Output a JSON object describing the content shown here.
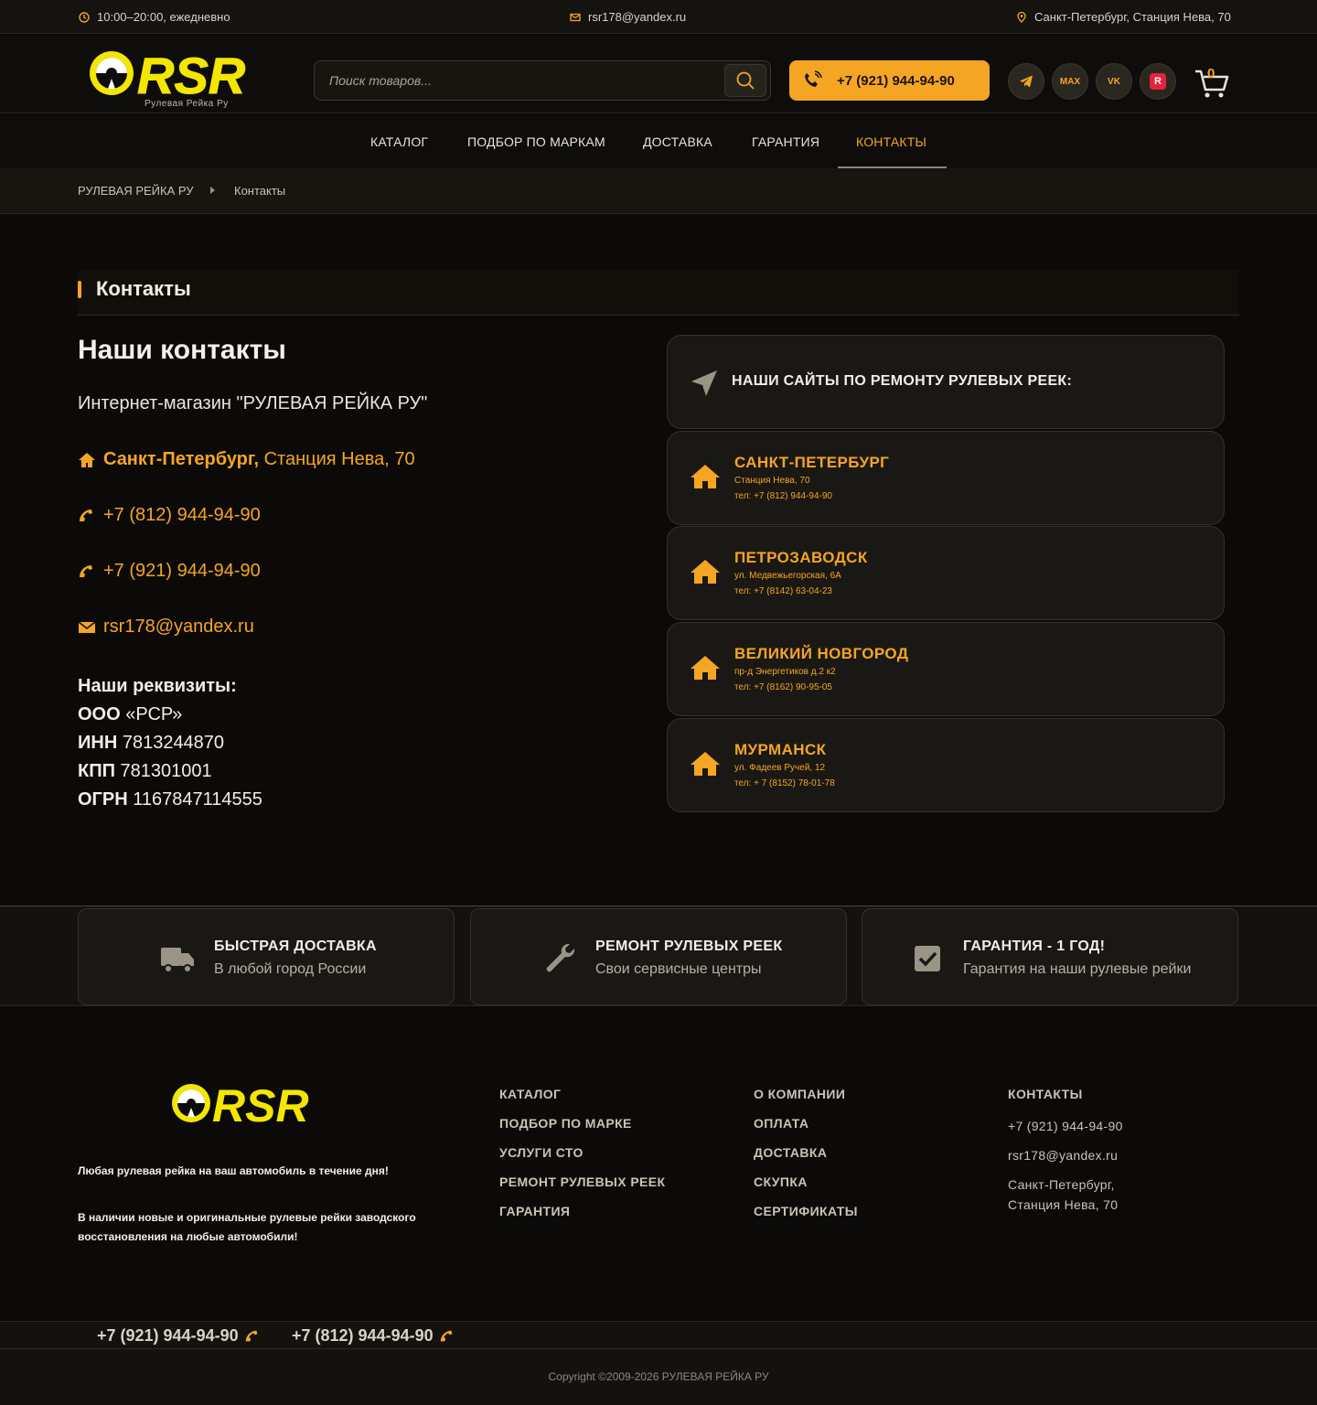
{
  "topbar": {
    "hours": "10:00–20:00, ежедневно",
    "email": "rsr178@yandex.ru",
    "address": "Санкт-Петербург, Станция Нева, 70"
  },
  "header": {
    "logo_text": "RSR",
    "logo_subtitle": "Рулевая Рейка Ру",
    "search_placeholder": "Поиск товаров...",
    "phone": "+7 (921) 944-94-90",
    "social": {
      "max": "MAX",
      "vk": "VK",
      "r": "R"
    },
    "cart_count": "0"
  },
  "nav": {
    "items": [
      {
        "label": "КАТАЛОГ"
      },
      {
        "label": "ПОДБОР ПО МАРКАМ"
      },
      {
        "label": "ДОСТАВКА"
      },
      {
        "label": "ГАРАНТИЯ"
      },
      {
        "label": "КОНТАКТЫ"
      }
    ],
    "active": "КОНТАКТЫ"
  },
  "breadcrumb": {
    "home": "РУЛЕВАЯ РЕЙКА РУ",
    "current": "Контакты"
  },
  "page": {
    "title": "Контакты",
    "heading": "Наши контакты",
    "shop_name": "Интернет-магазин \"РУЛЕВАЯ РЕЙКА РУ\"",
    "city": "Санкт-Петербург,",
    "street": " Станция Нева, 70",
    "phone1": "+7 (812) 944-94-90",
    "phone2": "+7 (921) 944-94-90",
    "email": "rsr178@yandex.ru",
    "requisites": {
      "title": "Наши реквизиты:",
      "org_label": "ООО",
      "org_value": " «РСР»",
      "inn_label": "ИНН",
      "inn_value": " 7813244870",
      "kpp_label": "КПП",
      "kpp_value": " 781301001",
      "ogrn_label": "ОГРН",
      "ogrn_value": " 1167847114555"
    }
  },
  "sites": {
    "heading": "НАШИ САЙТЫ ПО РЕМОНТУ РУЛЕВЫХ РЕЕК:",
    "cities": [
      {
        "name": "САНКТ-ПЕТЕРБУРГ",
        "address": "Станция Нева, 70",
        "tel": "тел: +7 (812) 944-94-90"
      },
      {
        "name": "ПЕТРОЗАВОДСК",
        "address": "ул. Медвежьегорская, 6А",
        "tel": "тел: +7 (8142) 63-04-23"
      },
      {
        "name": "ВЕЛИКИЙ НОВГОРОД",
        "address": "пр-д Энергетиков д.2 к2",
        "tel": "тел: +7 (8162) 90-95-05"
      },
      {
        "name": "МУРМАНСК",
        "address": "ул. Фадеев Ручей, 12",
        "tel": "тел: + 7 (8152) 78-01-78"
      }
    ]
  },
  "features": [
    {
      "title": "БЫСТРАЯ ДОСТАВКА",
      "subtitle": "В любой город России",
      "icon": "truck-icon"
    },
    {
      "title": "РЕМОНТ РУЛЕВЫХ РЕЕК",
      "subtitle": "Свои сервисные центры",
      "icon": "wrench-icon"
    },
    {
      "title": "ГАРАНТИЯ - 1 ГОД!",
      "subtitle": "Гарантия на наши рулевые рейки",
      "icon": "checkbox-icon"
    }
  ],
  "footer": {
    "tagline1": "Любая рулевая рейка на ваш автомобиль в течение дня!",
    "tagline2": "В наличии новые и оригинальные рулевые рейки заводского восстановления на любые автомобили!",
    "col1": [
      "КАТАЛОГ",
      "ПОДБОР ПО МАРКЕ",
      "УСЛУГИ СТО",
      "РЕМОНТ РУЛЕВЫХ РЕЕК",
      "ГАРАНТИЯ"
    ],
    "col2": [
      "О КОМПАНИИ",
      "ОПЛАТА",
      "ДОСТАВКА",
      "СКУПКА",
      "СЕРТИФИКАТЫ"
    ],
    "col3": {
      "title": "КОНТАКТЫ",
      "phone": "+7 (921) 944-94-90",
      "email": "rsr178@yandex.ru",
      "address": "Санкт-Петербург, Станция Нева, 70"
    },
    "phone_bar": [
      "+7 (921) 944-94-90",
      "+7 (812) 944-94-90"
    ],
    "copyright": "Copyright ©2009-2026 РУЛЕВАЯ РЕЙКА РУ"
  },
  "colors": {
    "accent": "#f5a524",
    "logo_yellow": "#f3e600",
    "background": "#0b0a08"
  }
}
